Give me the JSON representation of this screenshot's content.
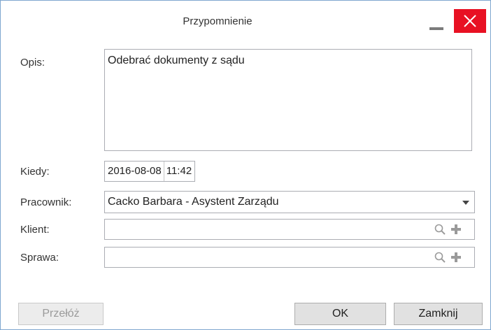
{
  "window": {
    "title": "Przypomnienie",
    "minimize_icon": "minimize-icon",
    "close_icon": "close-icon",
    "close_color": "#e81123"
  },
  "form": {
    "description": {
      "label": "Opis:",
      "value": "Odebrać dokumenty z sądu"
    },
    "when": {
      "label": "Kiedy:",
      "date": "2016-08-08",
      "time": "11:42"
    },
    "employee": {
      "label": "Pracownik:",
      "value": "Cacko Barbara - Asystent Zarządu",
      "icon": "chevron-down-icon"
    },
    "client": {
      "label": "Klient:",
      "value": "",
      "icons": [
        "search-icon",
        "plus-icon"
      ]
    },
    "case": {
      "label": "Sprawa:",
      "value": "",
      "icons": [
        "search-icon",
        "plus-icon"
      ]
    }
  },
  "buttons": {
    "postpone": "Przełóż",
    "ok": "OK",
    "close": "Zamknij"
  }
}
